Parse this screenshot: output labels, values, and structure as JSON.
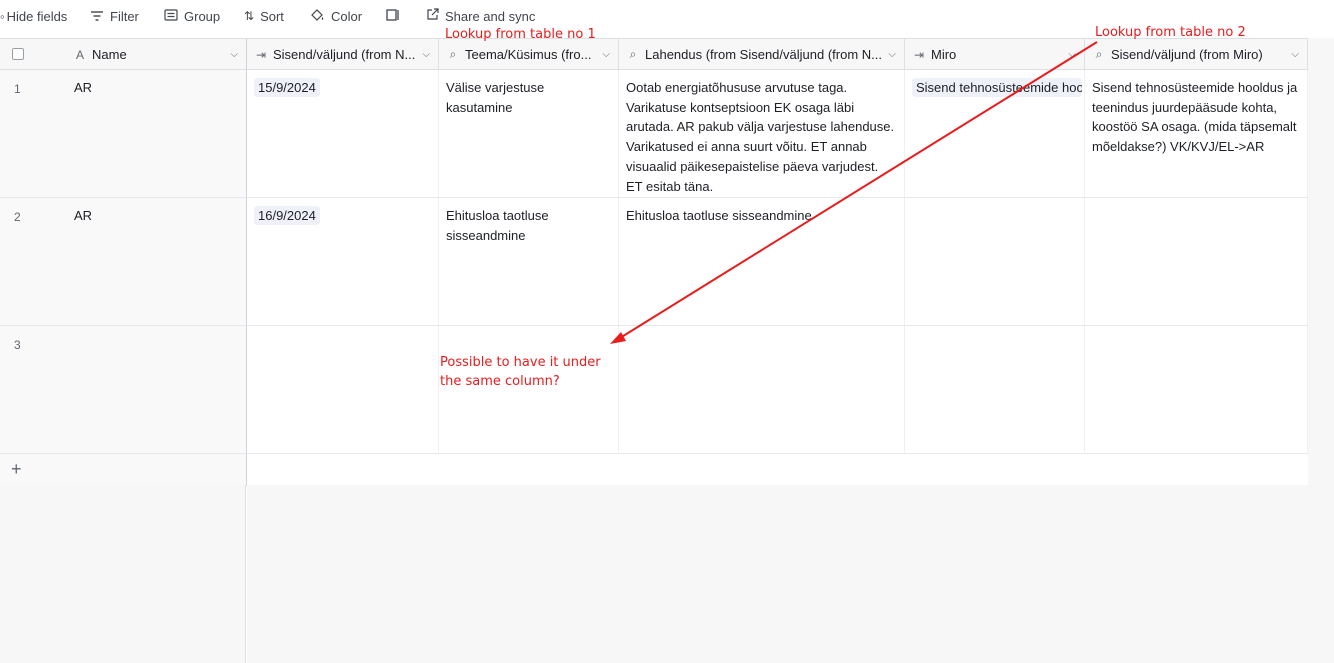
{
  "toolbar": {
    "hide_fields": "Hide fields",
    "filter": "Filter",
    "group": "Group",
    "sort": "Sort",
    "color": "Color",
    "share_sync": "Share and sync"
  },
  "columns": [
    {
      "label": "Name",
      "icon": "text-type-icon"
    },
    {
      "label": "Sisend/väljund (from N...",
      "icon": "linked-record-icon"
    },
    {
      "label": "Teema/Küsimus (fro...",
      "icon": "lookup-icon"
    },
    {
      "label": "Lahendus (from Sisend/väljund (from N...",
      "icon": "lookup-icon"
    },
    {
      "label": "Miro",
      "icon": "linked-record-icon"
    },
    {
      "label": "Sisend/väljund (from Miro)",
      "icon": "lookup-icon"
    }
  ],
  "rows": [
    {
      "num": "1",
      "name": "AR",
      "sisend": "15/9/2024",
      "teema": "Välise varjestuse kasutamine",
      "lahendus": "Ootab energiatõhususe arvutuse taga. Varikatuse kontseptsioon EK osaga läbi arutada. AR pakub välja varjestuse lahenduse. Varikatused ei anna suurt võitu. ET annab visuaalid päikesepaistelise päeva varjudest. ET esitab täna.",
      "miro": "Sisend tehnosüsteemide hooldus ja",
      "sisend_miro": "Sisend tehnosüsteemide hooldus ja teenindus juurdepääsude kohta, koostöö SA osaga. (mida täpsemalt mõeldakse?) VK/KVJ/EL->AR"
    },
    {
      "num": "2",
      "name": "AR",
      "sisend": "16/9/2024",
      "teema": "Ehitusloa taotluse sisseandmine",
      "lahendus": "Ehitusloa taotluse sisseandmine",
      "miro": "",
      "sisend_miro": ""
    },
    {
      "num": "3",
      "name": "",
      "sisend": "",
      "teema": "",
      "lahendus": "",
      "miro": "",
      "sisend_miro": ""
    }
  ],
  "annotations": {
    "lookup1": "Lookup from table no 1",
    "lookup2": "Lookup from table no 2",
    "question": "Possible to have it under the same column?",
    "color": "#e81c1c"
  }
}
